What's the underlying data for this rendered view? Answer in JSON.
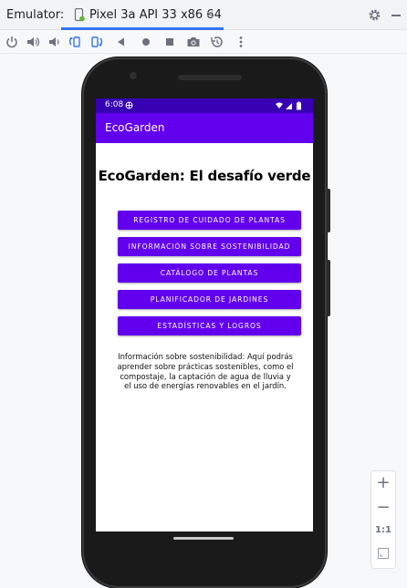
{
  "ide": {
    "emulator_label": "Emulator:",
    "device_tab": "Pixel 3a API 33 x86 64",
    "tab_close": "✕",
    "zoom": {
      "zoom_in": "+",
      "zoom_out": "−",
      "actual_size": "1:1"
    }
  },
  "phone": {
    "status_time": "6:08",
    "app_title": "EcoGarden",
    "heading": "EcoGarden: El desafío verde",
    "buttons": [
      "REGISTRO DE CUIDADO DE PLANTAS",
      "INFORMACIÓN SOBRE SOSTENIBILIDAD",
      "CATÁLOGO DE PLANTAS",
      "PLANIFICADOR DE JARDINES",
      "ESTADÍSTICAS Y LOGROS"
    ],
    "info_text": "Información sobre sostenibilidad: Aquí podrás aprender sobre prácticas sostenibles, como el compostaje, la captación de agua de lluvia y el uso de energías renovables en el jardín."
  },
  "colors": {
    "primary": "#6200ee",
    "status_bar": "#3700b3",
    "tab_accent": "#3574f0"
  }
}
